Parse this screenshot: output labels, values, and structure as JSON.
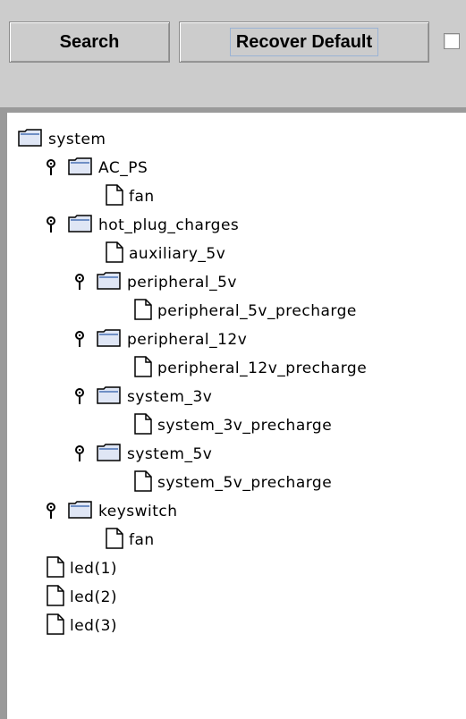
{
  "toolbar": {
    "search_label": "Search",
    "recover_label": "Recover Default"
  },
  "tree": {
    "nodes": [
      {
        "label": "system",
        "kind": "folder",
        "expandable": false
      },
      {
        "label": "AC_PS",
        "kind": "folder",
        "expandable": true
      },
      {
        "label": "fan",
        "kind": "file",
        "expandable": false
      },
      {
        "label": "hot_plug_charges",
        "kind": "folder",
        "expandable": true
      },
      {
        "label": "auxiliary_5v",
        "kind": "file",
        "expandable": false
      },
      {
        "label": "peripheral_5v",
        "kind": "folder",
        "expandable": true
      },
      {
        "label": "peripheral_5v_precharge",
        "kind": "file",
        "expandable": false
      },
      {
        "label": "peripheral_12v",
        "kind": "folder",
        "expandable": true
      },
      {
        "label": "peripheral_12v_precharge",
        "kind": "file",
        "expandable": false
      },
      {
        "label": "system_3v",
        "kind": "folder",
        "expandable": true
      },
      {
        "label": "system_3v_precharge",
        "kind": "file",
        "expandable": false
      },
      {
        "label": "system_5v",
        "kind": "folder",
        "expandable": true
      },
      {
        "label": "system_5v_precharge",
        "kind": "file",
        "expandable": false
      },
      {
        "label": "keyswitch",
        "kind": "folder",
        "expandable": true
      },
      {
        "label": "fan",
        "kind": "file",
        "expandable": false
      },
      {
        "label": "led(1)",
        "kind": "file",
        "expandable": false
      },
      {
        "label": "led(2)",
        "kind": "file",
        "expandable": false
      },
      {
        "label": "led(3)",
        "kind": "file",
        "expandable": false
      }
    ]
  },
  "colors": {
    "panel": "#cccccc",
    "folder_fill": "#dfe6f5",
    "folder_edge": "#000000"
  },
  "icons": {
    "handle": "expand-handle-icon",
    "folder": "folder-icon",
    "file": "file-icon"
  }
}
